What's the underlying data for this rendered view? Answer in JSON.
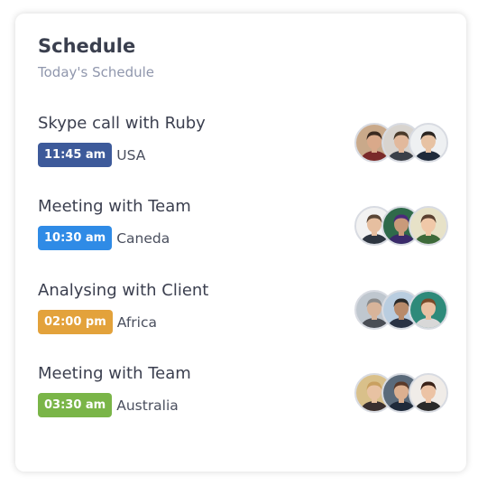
{
  "header": {
    "title": "Schedule",
    "subtitle": "Today's Schedule"
  },
  "items": [
    {
      "title": "Skype call with Ruby",
      "time": "11:45 am",
      "location": "USA",
      "badge_color": "#3d5a9a",
      "avatars": [
        {
          "icon": "person-avatar-icon",
          "bg": "#c9a98a",
          "skin": "#d9a98a",
          "hair": "#3a2a20",
          "shirt": "#7a2a2a"
        },
        {
          "icon": "person-avatar-icon",
          "bg": "#d8d4cf",
          "skin": "#e2b99c",
          "hair": "#4a3a2a",
          "shirt": "#3b4048"
        },
        {
          "icon": "person-avatar-icon",
          "bg": "#eef0f2",
          "skin": "#e7c2a3",
          "hair": "#2b2521",
          "shirt": "#1f2a3a"
        }
      ]
    },
    {
      "title": "Meeting with Team",
      "time": "10:30 am",
      "location": "Caneda",
      "badge_color": "#2f8be6",
      "avatars": [
        {
          "icon": "person-avatar-icon",
          "bg": "#f2f2f2",
          "skin": "#e6bfa0",
          "hair": "#5a4636",
          "shirt": "#2d3540"
        },
        {
          "icon": "person-avatar-icon",
          "bg": "#2f6a4a",
          "skin": "#c99a7a",
          "hair": "#4a2a7a",
          "shirt": "#3a2a6a"
        },
        {
          "icon": "person-avatar-icon",
          "bg": "#e7e2c8",
          "skin": "#f0c8a8",
          "hair": "#5a4030",
          "shirt": "#3d6a3a"
        }
      ]
    },
    {
      "title": "Analysing with Client",
      "time": "02:00 pm",
      "location": "Africa",
      "badge_color": "#e3a23b",
      "avatars": [
        {
          "icon": "person-avatar-icon",
          "bg": "#bfc7cf",
          "skin": "#d8b49a",
          "hair": "#8a8a8a",
          "shirt": "#4a4e55"
        },
        {
          "icon": "person-avatar-icon",
          "bg": "#b9cde0",
          "skin": "#b88a6a",
          "hair": "#2a2a2a",
          "shirt": "#2a3345"
        },
        {
          "icon": "person-avatar-icon",
          "bg": "#2e8a7a",
          "skin": "#e9c0a2",
          "hair": "#7a4a2a",
          "shirt": "#d8d8d8"
        }
      ]
    },
    {
      "title": "Meeting with Team",
      "time": "03:30 am",
      "location": "Australia",
      "badge_color": "#7ab548",
      "avatars": [
        {
          "icon": "person-avatar-icon",
          "bg": "#d9c08a",
          "skin": "#e8c2a2",
          "hair": "#c9a060",
          "shirt": "#3a3030"
        },
        {
          "icon": "person-avatar-icon",
          "bg": "#5a6a7a",
          "skin": "#dcb090",
          "hair": "#5a3a2a",
          "shirt": "#1f2a3a"
        },
        {
          "icon": "person-avatar-icon",
          "bg": "#f0ece8",
          "skin": "#ecc3a5",
          "hair": "#3a2218",
          "shirt": "#2a2a2a"
        }
      ]
    }
  ]
}
